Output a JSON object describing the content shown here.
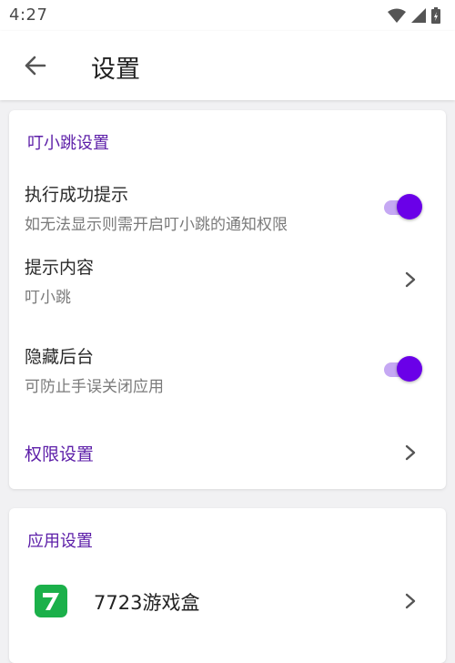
{
  "status_bar": {
    "time": "4:27"
  },
  "app_bar": {
    "title": "设置",
    "back_icon": "arrow-left-icon"
  },
  "sections": {
    "dingxiaotiao": {
      "header": "叮小跳设置",
      "items": {
        "success_tip": {
          "title": "执行成功提示",
          "subtitle": "如无法显示则需开启叮小跳的通知权限",
          "toggle_on": true
        },
        "tip_content": {
          "title": "提示内容",
          "subtitle": "叮小跳"
        },
        "hide_background": {
          "title": "隐藏后台",
          "subtitle": "可防止手误关闭应用",
          "toggle_on": true
        },
        "permissions": {
          "title": "权限设置"
        }
      }
    },
    "app_settings": {
      "header": "应用设置",
      "items": {
        "app_7723": {
          "title": "7723游戏盒",
          "icon": "7723-logo-icon"
        }
      }
    }
  },
  "colors": {
    "accent": "#6a00e8",
    "accent_track": "#c5a8f3",
    "section_header": "#5c1ea8",
    "background": "#f1f1f3",
    "logo_green": "#1bb04a"
  }
}
